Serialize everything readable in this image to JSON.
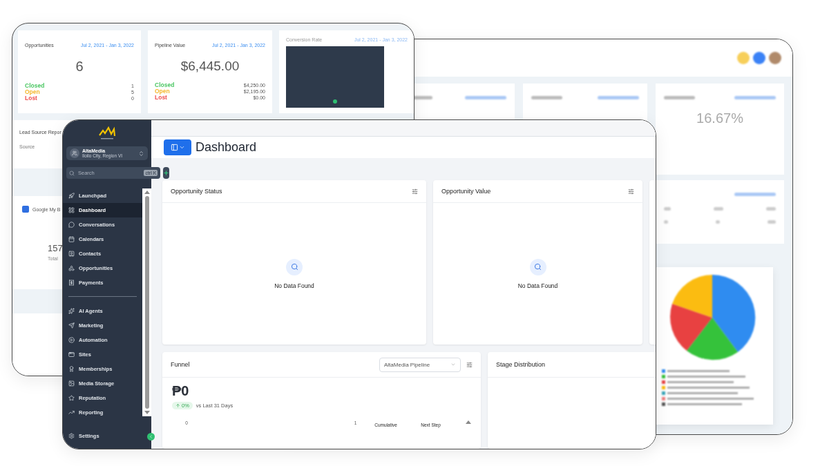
{
  "back_left_window": {
    "cards": [
      {
        "title": "Opportunities",
        "date_range": "Jul 2, 2021 - Jan 3, 2022",
        "value": "6",
        "rows": [
          {
            "label": "Closed",
            "value": "1",
            "color": "#4cc764"
          },
          {
            "label": "Open",
            "value": "5",
            "color": "#f5b82e"
          },
          {
            "label": "Lost",
            "value": "0",
            "color": "#ef4f4f"
          }
        ]
      },
      {
        "title": "Pipeline Value",
        "date_range": "Jul 2, 2021 - Jan 3, 2022",
        "value": "$6,445.00",
        "rows": [
          {
            "label": "Closed",
            "value": "$4,250.00",
            "color": "#4cc764"
          },
          {
            "label": "Open",
            "value": "$2,195.00",
            "color": "#f5b82e"
          },
          {
            "label": "Lost",
            "value": "$0.00",
            "color": "#ef4f4f"
          }
        ]
      }
    ],
    "conversion_card": {
      "title": "Conversion Rate",
      "date_range": "Jul 2, 2021 - Jan 3, 2022"
    },
    "lead_source": {
      "title": "Lead Source Repor",
      "column": "Source"
    },
    "google_card": {
      "title": "Google My B",
      "value": "157",
      "caption": "Total"
    }
  },
  "back_right_window": {
    "conversion_value": "16.67%"
  },
  "front_window": {
    "sidebar": {
      "account": {
        "name": "AltaMedia",
        "location": "Iloilo City, Region VI"
      },
      "search": {
        "placeholder": "Search",
        "shortcut": "ctrl K"
      },
      "sections": [
        {
          "items": [
            {
              "label": "Launchpad",
              "selected": false
            },
            {
              "label": "Dashboard",
              "selected": true
            },
            {
              "label": "Conversations",
              "selected": false
            },
            {
              "label": "Calendars",
              "selected": false
            },
            {
              "label": "Contacts",
              "selected": false
            },
            {
              "label": "Opportunities",
              "selected": false
            },
            {
              "label": "Payments",
              "selected": false
            }
          ]
        },
        {
          "items": [
            {
              "label": "AI Agents",
              "selected": false
            },
            {
              "label": "Marketing",
              "selected": false
            },
            {
              "label": "Automation",
              "selected": false
            },
            {
              "label": "Sites",
              "selected": false
            },
            {
              "label": "Memberships",
              "selected": false
            },
            {
              "label": "Media Storage",
              "selected": false
            },
            {
              "label": "Reputation",
              "selected": false
            },
            {
              "label": "Reporting",
              "selected": false
            }
          ]
        }
      ],
      "settings": {
        "label": "Settings",
        "selected": false
      }
    },
    "header": {
      "title": "Dashboard"
    },
    "widgets": [
      {
        "title": "Opportunity Status",
        "empty_text": "No Data Found"
      },
      {
        "title": "Opportunity Value",
        "empty_text": "No Data Found"
      }
    ],
    "funnel": {
      "title": "Funnel",
      "pipeline": "AltaMedia Pipeline",
      "amount": "₱0",
      "change": "0%",
      "comparison": "vs Last 31 Days",
      "axis_labels": [
        "0",
        "1"
      ],
      "columns": [
        "Cumulative",
        "Next Step"
      ]
    },
    "stage_distribution": {
      "title": "Stage Distribution"
    }
  }
}
